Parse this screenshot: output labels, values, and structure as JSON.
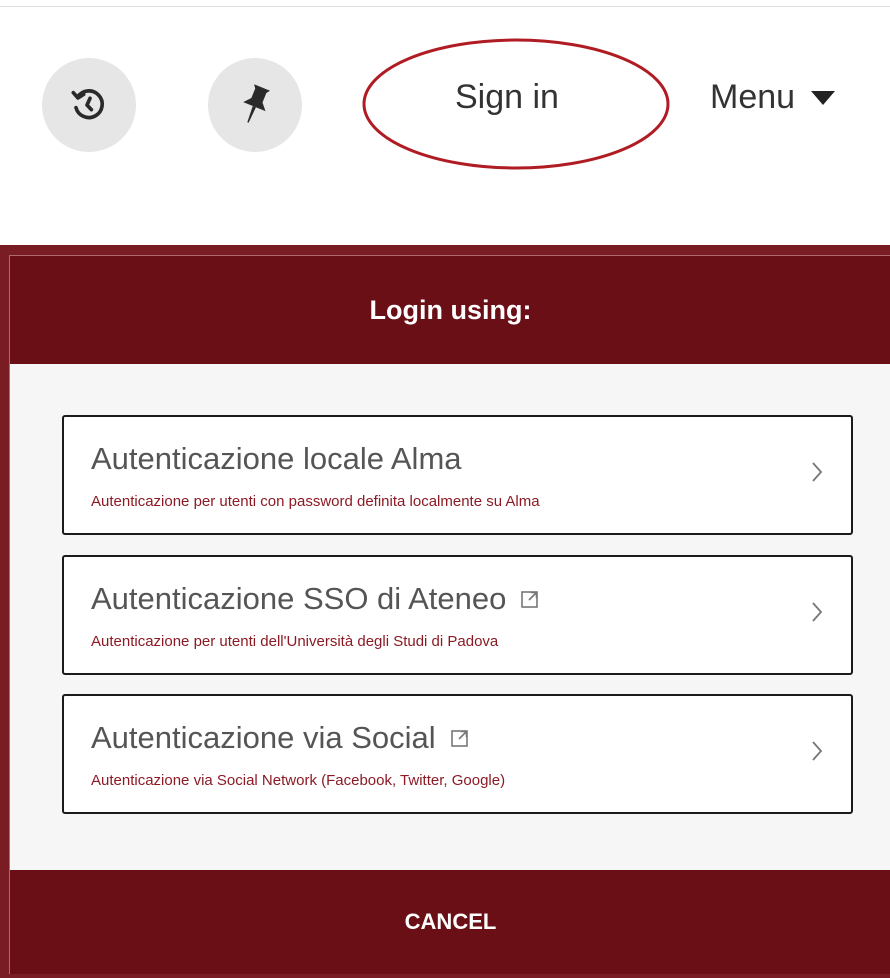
{
  "header": {
    "signin_label": "Sign in",
    "menu_label": "Menu",
    "history_icon": "history-icon",
    "pin_icon": "pin-icon",
    "annotation_color": "#b01c24"
  },
  "modal": {
    "title": "Login using:",
    "options": [
      {
        "title": "Autenticazione locale Alma",
        "subtitle": "Autenticazione per utenti con password definita localmente su Alma",
        "external": false
      },
      {
        "title": "Autenticazione SSO di Ateneo",
        "subtitle": "Autenticazione per utenti dell'Università degli Studi di Padova",
        "external": true
      },
      {
        "title": "Autenticazione via Social",
        "subtitle": "Autenticazione via Social Network (Facebook, Twitter, Google)",
        "external": true
      }
    ],
    "cancel_label": "CANCEL"
  },
  "colors": {
    "brand": "#6b0f17",
    "frame": "#7a1c24",
    "subtitle": "#8c1a24"
  }
}
